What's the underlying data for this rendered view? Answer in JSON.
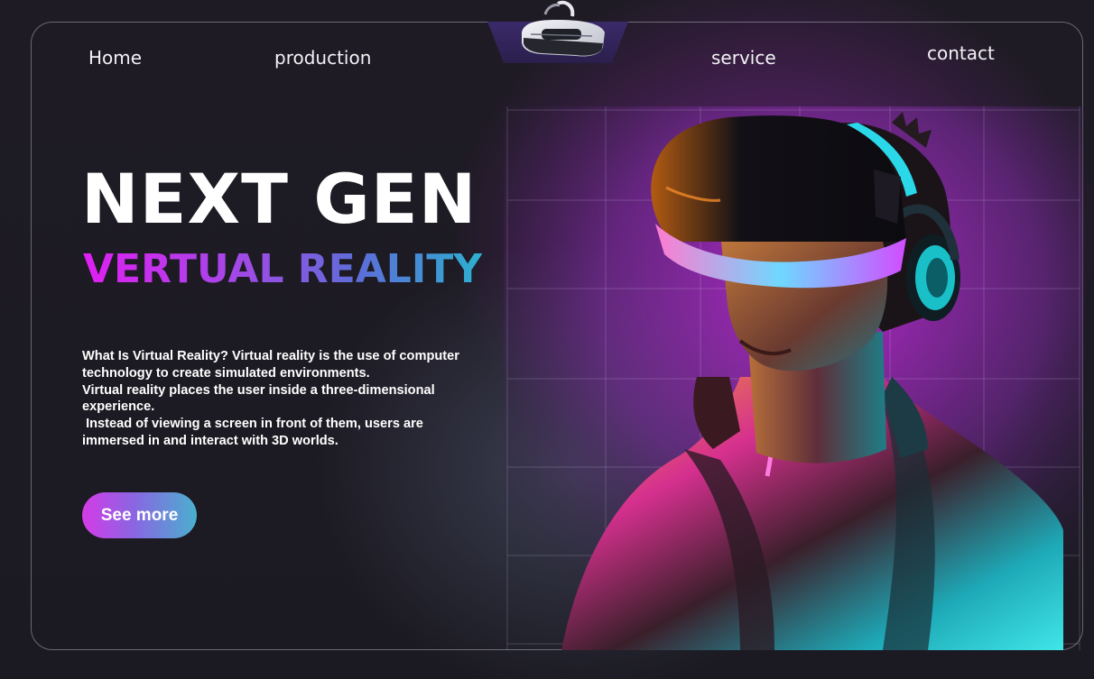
{
  "nav": {
    "home": "Home",
    "production": "production",
    "service": "service",
    "contact": "contact"
  },
  "hero": {
    "title": "NEXT GEN",
    "subtitle": "VERTUAL REALITY",
    "description": [
      "What Is Virtual Reality? Virtual reality is the use of computer technology to create simulated environments.",
      "Virtual reality places the user inside a three-dimensional experience.",
      " Instead of viewing a screen in front of them, users are immersed in and interact with 3D worlds."
    ],
    "cta_label": "See more"
  },
  "logo": {
    "icon": "vr-headset-icon"
  },
  "hero_image": {
    "icon": "vr-person-illustration"
  },
  "colors": {
    "background": "#1d1b22",
    "accent_pink": "#e01ff2",
    "accent_cyan": "#2cb0d0",
    "text": "#ffffff",
    "glow_purple": "#aa28c8"
  }
}
